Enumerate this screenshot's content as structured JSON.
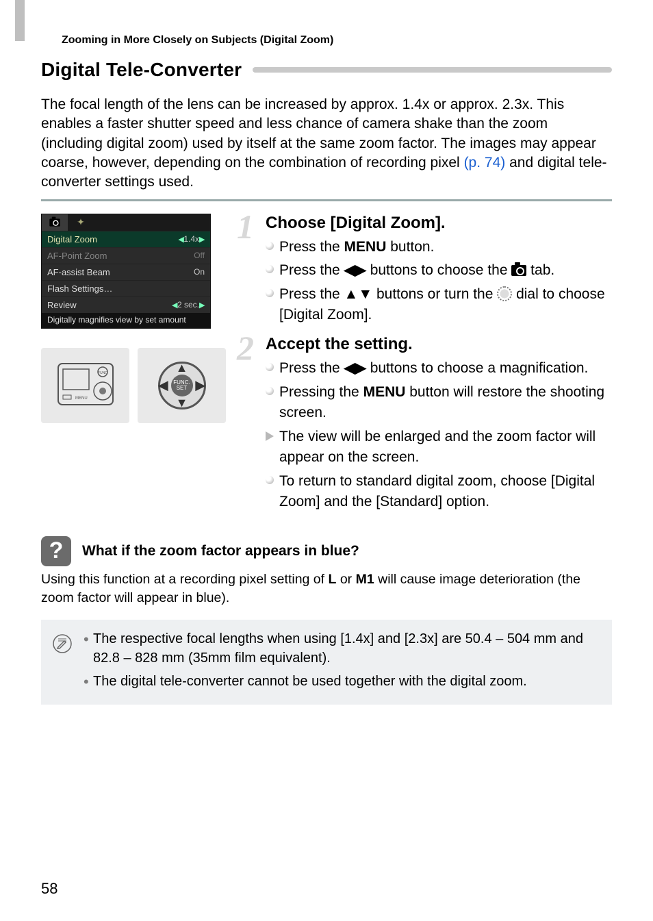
{
  "breadcrumb": "Zooming in More Closely on Subjects (Digital Zoom)",
  "section_title": "Digital Tele-Converter",
  "intro_pre": "The focal length of the lens can be increased by approx. 1.4x or approx. 2.3x. This enables a faster shutter speed and less chance of camera shake than the zoom (including digital zoom) used by itself at the same zoom factor. The images may appear coarse, however, depending on the combination of recording pixel ",
  "intro_link": "(p. 74)",
  "intro_post": " and digital tele-converter settings used.",
  "menu": {
    "rows": {
      "digital_zoom": {
        "label": "Digital Zoom",
        "value": "1.4x"
      },
      "af_point_zoom": {
        "label": "AF-Point Zoom",
        "value": "Off"
      },
      "af_assist": {
        "label": "AF-assist Beam",
        "value": "On"
      },
      "flash": {
        "label": "Flash Settings…",
        "value": ""
      },
      "review": {
        "label": "Review",
        "value": "2 sec."
      }
    },
    "footer": "Digitally magnifies view by set amount"
  },
  "dpad_label": "FUNC. SET",
  "steps": [
    {
      "num": "1",
      "title": "Choose [Digital Zoom].",
      "items": [
        {
          "kind": "dot",
          "segments": [
            {
              "t": "Press the "
            },
            {
              "t": "MENU",
              "cls": "menu-word"
            },
            {
              "t": " button."
            }
          ]
        },
        {
          "kind": "dot",
          "segments": [
            {
              "t": "Press the "
            },
            {
              "t": "◀▶",
              "cls": "glyph"
            },
            {
              "t": " buttons to choose the "
            },
            {
              "icon": "cam"
            },
            {
              "t": " tab."
            }
          ]
        },
        {
          "kind": "dot",
          "segments": [
            {
              "t": "Press the "
            },
            {
              "t": "▲▼",
              "cls": "glyph"
            },
            {
              "t": " buttons or turn the "
            },
            {
              "icon": "dial"
            },
            {
              "t": " dial to choose [Digital Zoom]."
            }
          ]
        }
      ]
    },
    {
      "num": "2",
      "title": "Accept the setting.",
      "items": [
        {
          "kind": "dot",
          "segments": [
            {
              "t": "Press the "
            },
            {
              "t": "◀▶",
              "cls": "glyph"
            },
            {
              "t": " buttons to choose a magnification."
            }
          ]
        },
        {
          "kind": "dot",
          "segments": [
            {
              "t": "Pressing the "
            },
            {
              "t": "MENU",
              "cls": "menu-word"
            },
            {
              "t": " button will restore the shooting screen."
            }
          ]
        },
        {
          "kind": "tri",
          "segments": [
            {
              "t": "The view will be enlarged and the zoom factor will appear on the screen."
            }
          ]
        },
        {
          "kind": "dot",
          "segments": [
            {
              "t": "To return to standard digital zoom, choose [Digital Zoom] and the [Standard] option."
            }
          ]
        }
      ]
    }
  ],
  "callout": {
    "title": "What if the zoom factor appears in blue?",
    "body_pre": "Using this function at a recording pixel setting of ",
    "body_mid1": "L",
    "body_mid2": " or ",
    "body_mid3": "M1",
    "body_post": " will cause image deterioration (the zoom factor will appear in blue)."
  },
  "notes": [
    "The respective focal lengths when using [1.4x] and [2.3x] are 50.4 – 504 mm and 82.8 – 828 mm (35mm film equivalent).",
    "The digital tele-converter cannot be used together with the digital zoom."
  ],
  "page_number": "58"
}
